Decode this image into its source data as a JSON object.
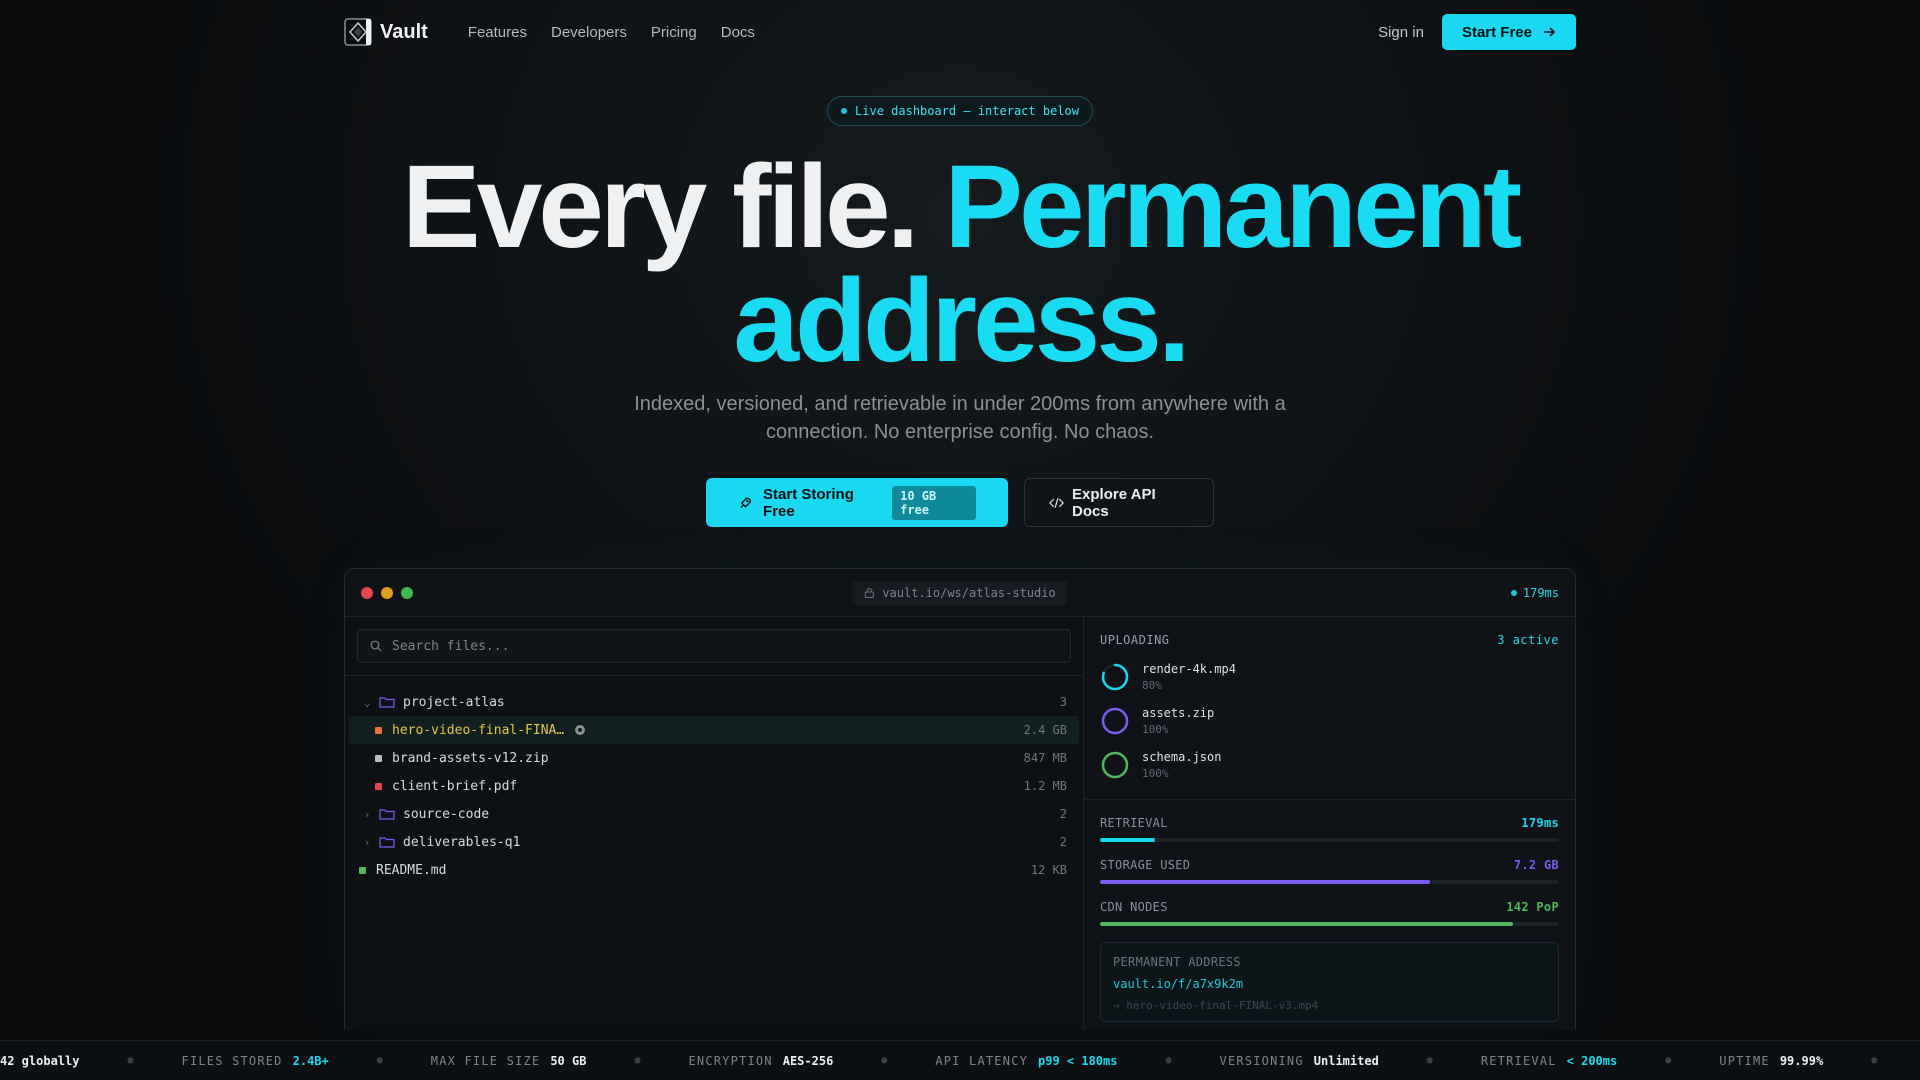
{
  "nav": {
    "brand": "Vault",
    "links": [
      "Features",
      "Developers",
      "Pricing",
      "Docs"
    ],
    "signin": "Sign in",
    "start": "Start Free"
  },
  "hero": {
    "pill": "Live dashboard — interact below",
    "headline_white": "Every file.",
    "headline_cyan_1": "Permanent",
    "headline_cyan_2": "address.",
    "sub_line1": "Indexed, versioned, and retrievable in under 200ms from anywhere with a",
    "sub_line2": "connection. No enterprise config. No chaos.",
    "cta_primary": "Start Storing Free",
    "cta_primary_tag": "10 GB free",
    "cta_secondary": "Explore API Docs"
  },
  "window": {
    "url": "vault.io/ws/atlas-studio",
    "latency": "179ms",
    "search_placeholder": "Search files...",
    "tree": [
      {
        "type": "folder",
        "name": "project-atlas",
        "count": "3",
        "open": true
      },
      {
        "type": "file",
        "name": "hero-video-final-FINA…",
        "size": "2.4 GB",
        "color": "#e8763a",
        "selected": true,
        "highlight": "#e3c84a"
      },
      {
        "type": "file",
        "name": "brand-assets-v12.zip",
        "size": "847 MB",
        "color": "#b9bec3"
      },
      {
        "type": "file",
        "name": "client-brief.pdf",
        "size": "1.2 MB",
        "color": "#e9474d"
      },
      {
        "type": "folder",
        "name": "source-code",
        "count": "2",
        "open": false
      },
      {
        "type": "folder",
        "name": "deliverables-q1",
        "count": "2",
        "open": false
      },
      {
        "type": "root-file",
        "name": "README.md",
        "size": "12 KB",
        "color": "#4fb85a"
      }
    ],
    "uploading": {
      "label": "UPLOADING",
      "active": "3 active",
      "items": [
        {
          "name": "render-4k.mp4",
          "pct": "80%",
          "progress": 0.8,
          "color": "#19d8ef"
        },
        {
          "name": "assets.zip",
          "pct": "100%",
          "progress": 1.0,
          "color": "#7b5cf0"
        },
        {
          "name": "schema.json",
          "pct": "100%",
          "progress": 1.0,
          "color": "#4fb85a"
        }
      ]
    },
    "metrics": [
      {
        "label": "RETRIEVAL",
        "value": "179ms",
        "fraction": 0.12,
        "color": "#19d8ef"
      },
      {
        "label": "STORAGE USED",
        "value": "7.2 GB",
        "fraction": 0.72,
        "color": "#7b5cf0"
      },
      {
        "label": "CDN NODES",
        "value": "142 PoP",
        "fraction": 0.9,
        "color": "#4fb85a"
      }
    ],
    "permanent": {
      "label": "PERMANENT ADDRESS",
      "url": "vault.io/f/a7x9k2m",
      "file": "→ hero-video-final-FINAL-v3.mp4"
    }
  },
  "ticker": {
    "lead": "42 globally",
    "items": [
      {
        "label": "FILES STORED",
        "value": "2.4B+",
        "color": "#19d8ef"
      },
      {
        "label": "MAX FILE SIZE",
        "value": "50 GB",
        "color": "#eef0f2"
      },
      {
        "label": "ENCRYPTION",
        "value": "AES-256",
        "color": "#eef0f2"
      },
      {
        "label": "API LATENCY",
        "value": "p99 < 180ms",
        "color": "#19d8ef"
      },
      {
        "label": "VERSIONING",
        "value": "Unlimited",
        "color": "#eef0f2"
      },
      {
        "label": "RETRIEVAL",
        "value": "< 200ms",
        "color": "#19d8ef"
      },
      {
        "label": "UPTIME",
        "value": "99.99%",
        "color": "#eef0f2"
      }
    ]
  },
  "colors": {
    "accent": "#19d8ef",
    "purple": "#7b5cf0",
    "green": "#4fb85a"
  }
}
